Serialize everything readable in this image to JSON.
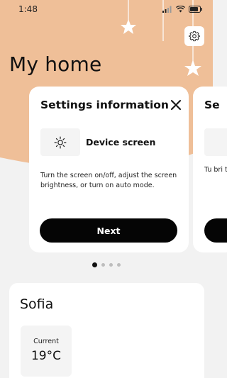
{
  "colors": {
    "hero_background": "#efbf98",
    "page_background": "#f2f2f2",
    "card_background": "#ffffff",
    "button_background": "#050505"
  },
  "status_bar": {
    "time": "1:48",
    "icons": [
      "signal-icon",
      "wifi-icon",
      "battery-icon"
    ]
  },
  "header": {
    "title": "My home",
    "settings_icon": "gear-icon"
  },
  "carousel": {
    "card": {
      "title": "Settings information",
      "close_icon": "close-icon",
      "device_icon": "sun-brightness-icon",
      "device_label": "Device screen",
      "description": "Turn the screen on/off, adjust the screen brightness, or turn on auto mode.",
      "button_label": "Next"
    },
    "next_card_peek": {
      "title": "Se",
      "description": "Tu bri the 'te"
    },
    "page_count": 4,
    "active_page": 1
  },
  "room": {
    "name": "Sofia",
    "current_label": "Current",
    "current_temp": "19°C"
  }
}
